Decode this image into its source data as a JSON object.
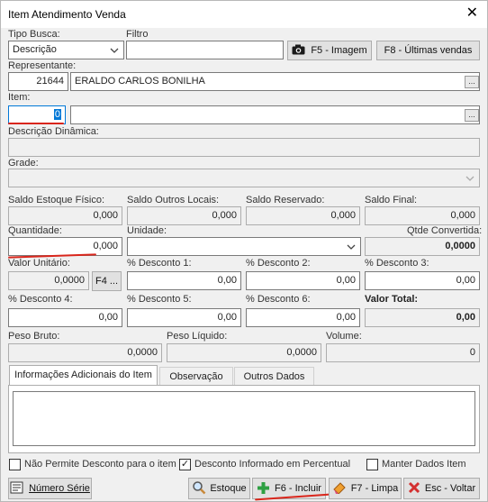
{
  "window": {
    "title": "Item Atendimento Venda"
  },
  "search": {
    "type_label": "Tipo Busca:",
    "type_value": "Descrição",
    "filter_label": "Filtro",
    "filter_value": ""
  },
  "toolbar": {
    "image_button": "F5 - Imagem",
    "last_sales_button": "F8 - Últimas vendas"
  },
  "representative": {
    "label": "Representante:",
    "code": "21644",
    "name": "ERALDO CARLOS BONILHA",
    "lookup": "..."
  },
  "item": {
    "label": "Item:",
    "code": "0",
    "description": "",
    "lookup": "..."
  },
  "dynamic_description": {
    "label": "Descrição Dinâmica:",
    "value": ""
  },
  "grid": {
    "label": "Grade:",
    "value": ""
  },
  "stock": {
    "physical_label": "Saldo Estoque Físico:",
    "physical_value": "0,000",
    "other_label": "Saldo Outros Locais:",
    "other_value": "0,000",
    "reserved_label": "Saldo Reservado:",
    "reserved_value": "0,000",
    "final_label": "Saldo Final:",
    "final_value": "0,000"
  },
  "quantity": {
    "label": "Quantidade:",
    "value": "0,000",
    "unit_label": "Unidade:",
    "unit_value": "",
    "converted_label": "Qtde Convertida:",
    "converted_value": "0,0000"
  },
  "pricing": {
    "unit_value_label": "Valor Unitário:",
    "unit_value": "0,0000",
    "f4_button": "F4 ...",
    "d1_label": "% Desconto 1:",
    "d1_value": "0,00",
    "d2_label": "% Desconto 2:",
    "d2_value": "0,00",
    "d3_label": "% Desconto 3:",
    "d3_value": "0,00",
    "d4_label": "% Desconto 4:",
    "d4_value": "0,00",
    "d5_label": "% Desconto 5:",
    "d5_value": "0,00",
    "d6_label": "% Desconto 6:",
    "d6_value": "0,00",
    "total_label": "Valor Total:",
    "total_value": "0,00"
  },
  "weights": {
    "gross_label": "Peso Bruto:",
    "gross_value": "0,0000",
    "net_label": "Peso Líquido:",
    "net_value": "0,0000",
    "volume_label": "Volume:",
    "volume_value": "0"
  },
  "tabs": [
    {
      "label": "Informações Adicionais do Item"
    },
    {
      "label": "Observação"
    },
    {
      "label": "Outros Dados"
    }
  ],
  "options": {
    "no_discount": "Não Permite Desconto para o item",
    "discount_percent": "Desconto Informado em Percentual",
    "keep_data": "Manter Dados Item"
  },
  "footer": {
    "serial_button": "Número Série",
    "stock_button": "Estoque",
    "include_button": "F6 - Incluir",
    "clear_button": "F7 - Limpa",
    "back_button": "Esc - Voltar"
  },
  "colors": {
    "accent_red": "#d9261c",
    "include_green": "#2ea043",
    "back_red": "#d32f2f"
  }
}
